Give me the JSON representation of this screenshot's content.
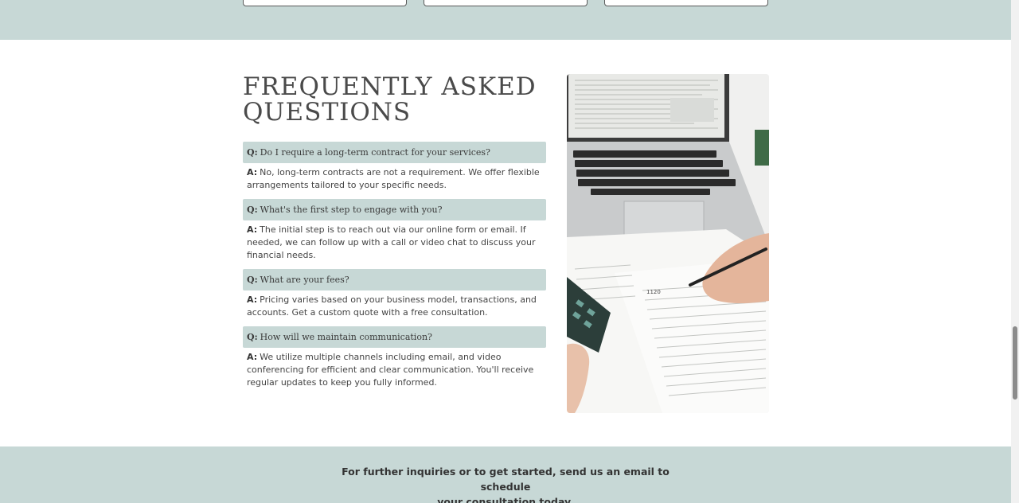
{
  "faq": {
    "title_line1": "FREQUENTLY ASKED",
    "title_line2": "QUESTIONS",
    "q_label": "Q:",
    "a_label": "A:",
    "items": [
      {
        "question": "Do I require a long-term contract for your services?",
        "answer": "No, long-term contracts are not a requirement. We offer flexible arrangements tailored to your specific needs."
      },
      {
        "question": "What's the first step to engage with you?",
        "answer": "The initial step is to reach out via our online form or email. If needed, we can follow up with a call or video chat to discuss your financial needs."
      },
      {
        "question": "What are your fees?",
        "answer": "Pricing varies based on your business model, transactions, and accounts. Get a custom quote with a free consultation."
      },
      {
        "question": "How will we maintain communication?",
        "answer": "We utilize multiple channels including email, and video conferencing for efficient and clear communication. You'll receive regular updates to keep you fully informed."
      }
    ]
  },
  "cta": {
    "line1": "For further inquiries or to get started, send us an email to schedule",
    "line2": "your consultation today."
  },
  "colors": {
    "band": "#c7d8d6",
    "question_bg": "#c7d8d6",
    "text": "#444444"
  }
}
